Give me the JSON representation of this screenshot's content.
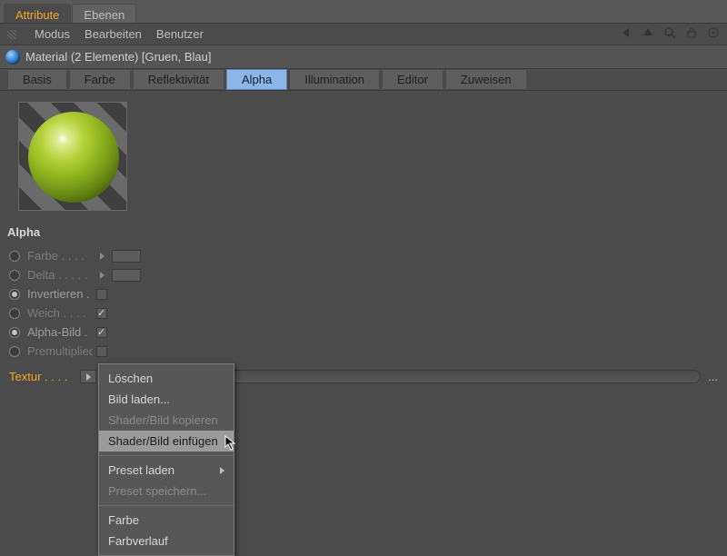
{
  "tabs": {
    "attribute": "Attribute",
    "layers": "Ebenen"
  },
  "menu": {
    "modus": "Modus",
    "bearbeiten": "Bearbeiten",
    "benutzer": "Benutzer"
  },
  "title": "Material (2 Elemente) [Gruen, Blau]",
  "proptabs": {
    "basis": "Basis",
    "farbe": "Farbe",
    "reflekt": "Reflektivität",
    "alpha": "Alpha",
    "illum": "Illumination",
    "editor": "Editor",
    "zuweisen": "Zuweisen"
  },
  "section": "Alpha",
  "params": {
    "farbe": "Farbe",
    "delta": "Delta",
    "invertieren": "Invertieren",
    "weich": "Weich",
    "alphabild": "Alpha-Bild",
    "premultiplied": "Premultiplied"
  },
  "texturLabel": "Textur",
  "ellipsis": "...",
  "popup": {
    "loeschen": "Löschen",
    "bildladen": "Bild laden...",
    "kopieren": "Shader/Bild kopieren",
    "einfuegen": "Shader/Bild einfügen",
    "presetladen": "Preset laden",
    "presetspeichern": "Preset speichern...",
    "farbe": "Farbe",
    "farbverlauf": "Farbverlauf"
  }
}
